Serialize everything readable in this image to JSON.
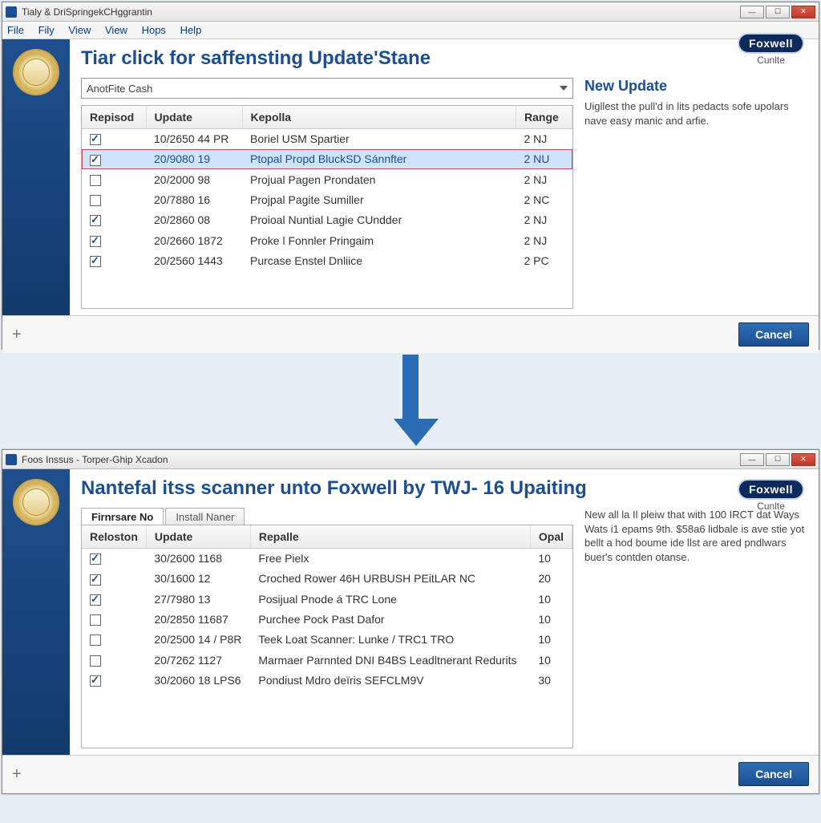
{
  "windowA": {
    "title": "Tialy & DriSpringekCHggrantin",
    "menu": [
      "File",
      "Fily",
      "View",
      "View",
      "Hops",
      "Help"
    ],
    "heading": "Tiar click for saffensting Update'Stane",
    "combo": "AnotFite Cash",
    "columns": {
      "c0": "Repisod",
      "c1": "Update",
      "c2": "Kepolla",
      "c3": "Range"
    },
    "rows": [
      {
        "checked": true,
        "update": "10/2650 44 PR",
        "desc": "Boriel USM Spartier",
        "range": "2 NJ",
        "selected": false
      },
      {
        "checked": true,
        "update": "20/9080 19",
        "desc": "Ptopal Propd BluckSD Sánnfter",
        "range": "2 NU",
        "selected": true
      },
      {
        "checked": false,
        "update": "20/2000 98",
        "desc": "Projual Pagen Prondaten",
        "range": "2 NJ",
        "selected": false
      },
      {
        "checked": false,
        "update": "20/7880 16",
        "desc": "Projpal Pagite Sumiller",
        "range": "2 NC",
        "selected": false
      },
      {
        "checked": true,
        "update": "20/2860 08",
        "desc": "Proioal Nuntial Lagie CUndder",
        "range": "2 NJ",
        "selected": false
      },
      {
        "checked": true,
        "update": "20/2660 1872",
        "desc": "Proke l Fonnler Pringaim",
        "range": "2 NJ",
        "selected": false
      },
      {
        "checked": true,
        "update": "20/2560 1443",
        "desc": "Purcase Enstel Dnliice",
        "range": "2 PC",
        "selected": false
      }
    ],
    "side_heading": "New Update",
    "side_text": "Uigllest the pull'd in lits pedacts sofe upolars nave easy manic and arfie.",
    "brand": "Foxwell",
    "brand_sub": "Cunlte",
    "cancel": "Cancel"
  },
  "windowB": {
    "title": "Foos Inssus - Torper-Ghip Xcadon",
    "heading": "Nantefal itss scanner unto Foxwell by TWJ- 16 Upaiting",
    "tabs": {
      "t0": "Firnrsare No",
      "t1": "Install Naner"
    },
    "columns": {
      "c0": "Reloston",
      "c1": "Update",
      "c2": "Repalle",
      "c3": "Opal"
    },
    "rows": [
      {
        "checked": true,
        "update": "30/2600 1168",
        "desc": "Free Pielx",
        "range": "10"
      },
      {
        "checked": true,
        "update": "30/1600 12",
        "desc": "Croched Rower 46H URBUSH PEitLAR NC",
        "range": "20"
      },
      {
        "checked": true,
        "update": "27/7980 13",
        "desc": "Posijual Pnode á TRC Lone",
        "range": "10"
      },
      {
        "checked": false,
        "update": "20/2850 11687",
        "desc": "Purchee Pock Past Dafor",
        "range": "10"
      },
      {
        "checked": false,
        "update": "20/2500 14 / P8R",
        "desc": "Teek Loat Scanner: Lunke / TRC1 TRO",
        "range": "10"
      },
      {
        "checked": false,
        "update": "20/7262 1127",
        "desc": "Marmaer Parnnted DNI B4BS Leadltnerant Redurits",
        "range": "10"
      },
      {
        "checked": true,
        "update": "30/2060 18 LPS6",
        "desc": "Pondiust Mdro deïris SEFCLM9V",
        "range": "30"
      }
    ],
    "side_text": "New all la Il pleiw that with 100 IRCT dat Ways Wats i1 epams 9th. $58a6 lidbale is ave stie yot bellt a hod boume ide llst are ared pndlwars buer's contden otanse.",
    "brand": "Foxwell",
    "brand_sub": "Cunlte",
    "cancel": "Cancel"
  }
}
